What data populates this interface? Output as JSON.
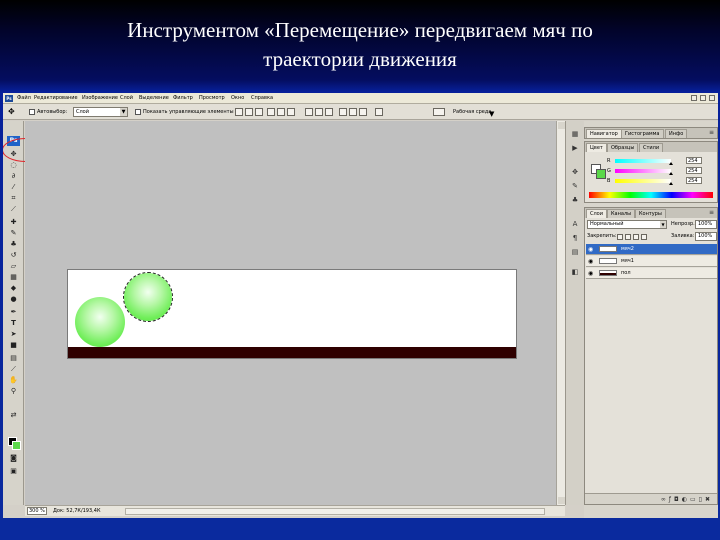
{
  "slide": {
    "title_line1": "Инструментом «Перемещение» передвигаем мяч по",
    "title_line2": "траектории движения"
  },
  "menubar": {
    "logo": "Ps",
    "items": [
      "Файл",
      "Редактирование",
      "Изображение",
      "Слой",
      "Выделение",
      "Фильтр",
      "Просмотр",
      "Окно",
      "Справка"
    ]
  },
  "options": {
    "autoselect_label": "Автовыбор:",
    "autoselect_value": "Слой",
    "show_controls_label": "Показать управляющие элементы",
    "workspace_label": "Рабочая среда"
  },
  "toolbox": {
    "logo": "Ps",
    "tools": [
      "move-tool",
      "marquee-tool",
      "lasso-tool",
      "magic-wand-tool",
      "crop-tool",
      "slice-tool",
      "healing-brush-tool",
      "brush-tool",
      "clone-stamp-tool",
      "history-brush-tool",
      "eraser-tool",
      "gradient-tool",
      "blur-tool",
      "dodge-tool",
      "pen-tool",
      "type-tool",
      "path-selection-tool",
      "shape-tool",
      "notes-tool",
      "eyedropper-tool",
      "hand-tool",
      "zoom-tool"
    ],
    "foreground_color": "#000000",
    "background_color": "#5bd84a"
  },
  "status": {
    "zoom": "300 %",
    "doc_info": "Док: 52,7К/193,4К"
  },
  "navigator_panel": {
    "tabs": [
      "Навигатор",
      "Гистограмма",
      "Инфо"
    ]
  },
  "color_panel": {
    "tabs": [
      "Цвет",
      "Образцы",
      "Стили"
    ],
    "channels": [
      {
        "label": "R",
        "value": "254"
      },
      {
        "label": "G",
        "value": "254"
      },
      {
        "label": "B",
        "value": "254"
      }
    ]
  },
  "layers_panel": {
    "tabs": [
      "Слои",
      "Каналы",
      "Контуры"
    ],
    "blend_mode": "Нормальный",
    "opacity_label": "Непрозр.:",
    "opacity_value": "100%",
    "lock_label": "Закрепить:",
    "fill_label": "Заливка:",
    "fill_value": "100%",
    "layers": [
      {
        "name": "мяч2",
        "selected": true
      },
      {
        "name": "мяч1",
        "selected": false
      },
      {
        "name": "пол",
        "selected": false
      }
    ]
  }
}
